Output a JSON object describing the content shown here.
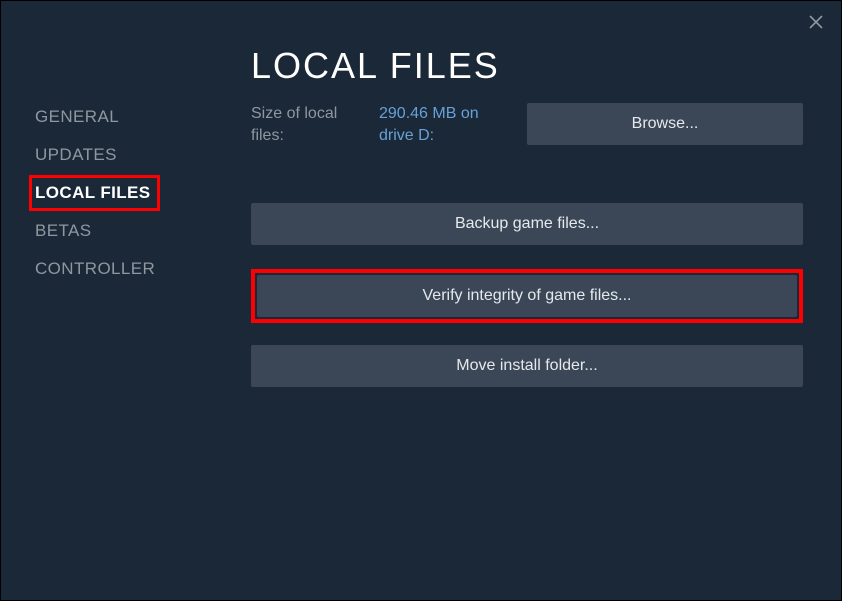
{
  "sidebar": {
    "items": [
      {
        "label": "GENERAL"
      },
      {
        "label": "UPDATES"
      },
      {
        "label": "LOCAL FILES"
      },
      {
        "label": "BETAS"
      },
      {
        "label": "CONTROLLER"
      }
    ],
    "selected_index": 2
  },
  "main": {
    "title": "LOCAL FILES",
    "size_label": "Size of local files:",
    "size_value": "290.46 MB on drive D:",
    "browse_button": "Browse...",
    "backup_button": "Backup game files...",
    "verify_button": "Verify integrity of game files...",
    "move_button": "Move install folder..."
  }
}
